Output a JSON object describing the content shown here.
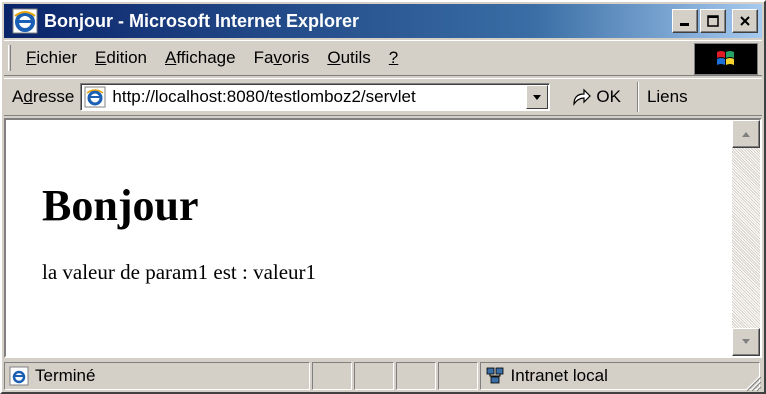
{
  "window": {
    "title": "Bonjour - Microsoft Internet Explorer"
  },
  "menu": {
    "items": [
      {
        "accel": "F",
        "rest": "ichier"
      },
      {
        "accel": "E",
        "rest": "dition"
      },
      {
        "accel": "A",
        "rest": "ffichage"
      },
      {
        "pre": "Fa",
        "accel": "v",
        "rest": "oris"
      },
      {
        "accel": "O",
        "rest": "utils"
      },
      {
        "accel": "?",
        "rest": ""
      }
    ]
  },
  "address": {
    "label_pre": "A",
    "label_accel": "d",
    "label_rest": "resse",
    "url": "http://localhost:8080/testlomboz2/servlet",
    "go_label": "OK",
    "links_label": "Liens"
  },
  "page": {
    "heading": "Bonjour",
    "text": "la valeur de param1 est : valeur1"
  },
  "status": {
    "text": "Terminé",
    "zone": "Intranet local"
  },
  "icons": {
    "title": "ie-logo-icon",
    "address": "ie-page-icon",
    "go": "go-arrow-icon",
    "status": "ie-page-icon",
    "zone": "intranet-zone-icon"
  }
}
